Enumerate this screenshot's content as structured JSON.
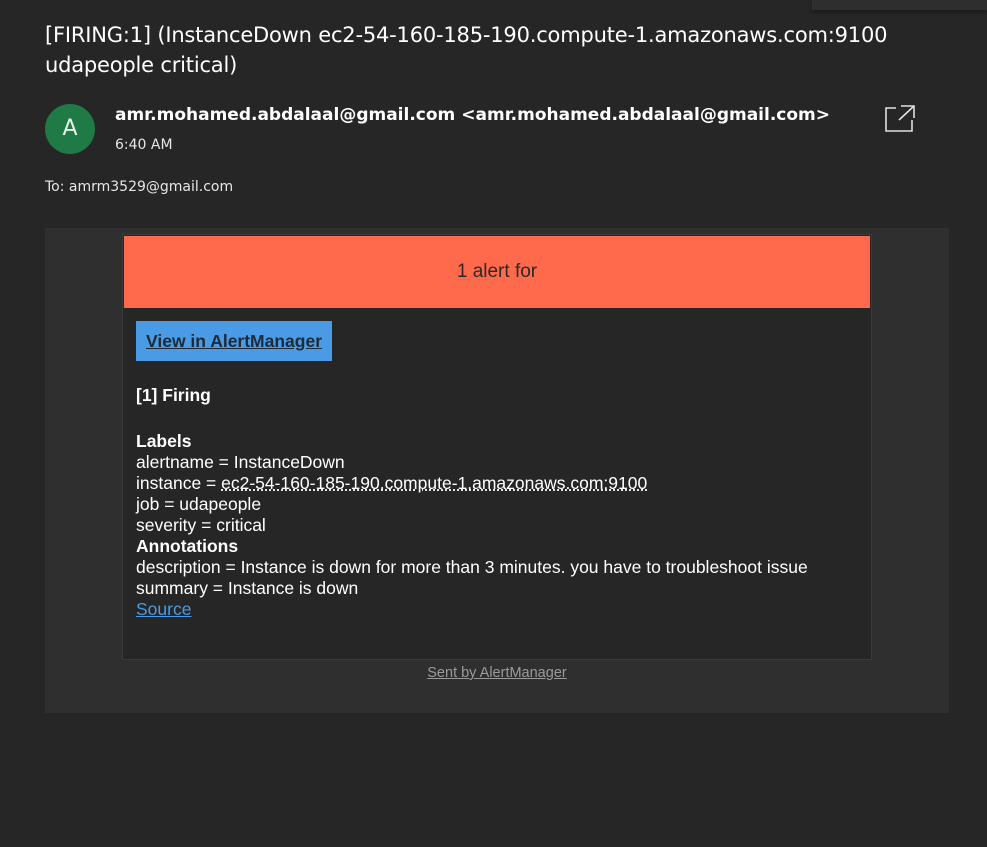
{
  "email": {
    "subject": "[FIRING:1]  (InstanceDown ec2-54-160-185-190.compute-1.amazonaws.com:9100 udapeople critical)",
    "avatar_letter": "A",
    "avatar_color": "#1f7a45",
    "sender_name": "amr.mohamed.abdalaal@gmail.com",
    "sender_address": "<amr.mohamed.abdalaal@gmail.com>",
    "time": "6:40 AM",
    "to": "To: amrm3529@gmail.com",
    "popout_icon": "popout-icon"
  },
  "alert": {
    "banner_text": "1 alert for",
    "banner_color": "#ff6a4d",
    "view_button_label": "View in AlertManager",
    "firing_heading": "[1] Firing",
    "labels_heading": "Labels",
    "labels": {
      "alertname_key": "alertname = ",
      "alertname_value": "InstanceDown",
      "instance_key": "instance = ",
      "instance_value": "ec2-54-160-185-190.compute-1.amazonaws.com:9100",
      "job": "job = udapeople",
      "severity": "severity = critical"
    },
    "annotations_heading": "Annotations",
    "annotations": {
      "description": "description = Instance is down for more than 3 minutes. you have to troubleshoot issue",
      "summary": "summary = Instance is down"
    },
    "source_link": "Source",
    "footer": "Sent by AlertManager",
    "link_color": "#4a9ae4"
  }
}
